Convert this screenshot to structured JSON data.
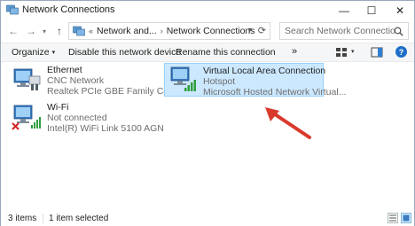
{
  "window": {
    "title": "Network Connections",
    "minimize_glyph": "—",
    "maximize_glyph": "☐",
    "close_glyph": "✕"
  },
  "address": {
    "back_glyph": "←",
    "forward_glyph": "→",
    "recent_glyph": "▾",
    "up_glyph": "↑",
    "prefix": "«",
    "crumbs": [
      "Network and...",
      "Network Connections"
    ],
    "separator": "›",
    "dropdown_glyph": "▾",
    "refresh_glyph": "⟳",
    "search_placeholder": "Search Network Connections"
  },
  "commands": {
    "organize": "Organize",
    "organize_dd": "▾",
    "disable": "Disable this network device",
    "rename": "Rename this connection",
    "more": "»",
    "view_dd": "▾",
    "help": "?"
  },
  "connections": [
    {
      "name": "Ethernet",
      "status": "CNC Network",
      "device": "Realtek PCIe GBE Family Controller",
      "icon": "ethernet-adapter-icon",
      "selected": false
    },
    {
      "name": "Wi-Fi",
      "status": "Not connected",
      "device": "Intel(R) WiFi Link 5100 AGN",
      "icon": "wifi-adapter-disconnected-icon",
      "selected": false
    },
    {
      "name": "Virtual Local Area Connection",
      "status": "Hotspot",
      "device": "Microsoft Hosted Network Virtual...",
      "icon": "wireless-adapter-connected-icon",
      "selected": true
    }
  ],
  "statusbar": {
    "item_count": "3 items",
    "selection": "1 item selected"
  },
  "colors": {
    "selection_bg": "#cce8ff",
    "selection_border": "#99d1ff",
    "annotation_arrow": "#d9392b",
    "signal_green": "#2e9e3e"
  }
}
